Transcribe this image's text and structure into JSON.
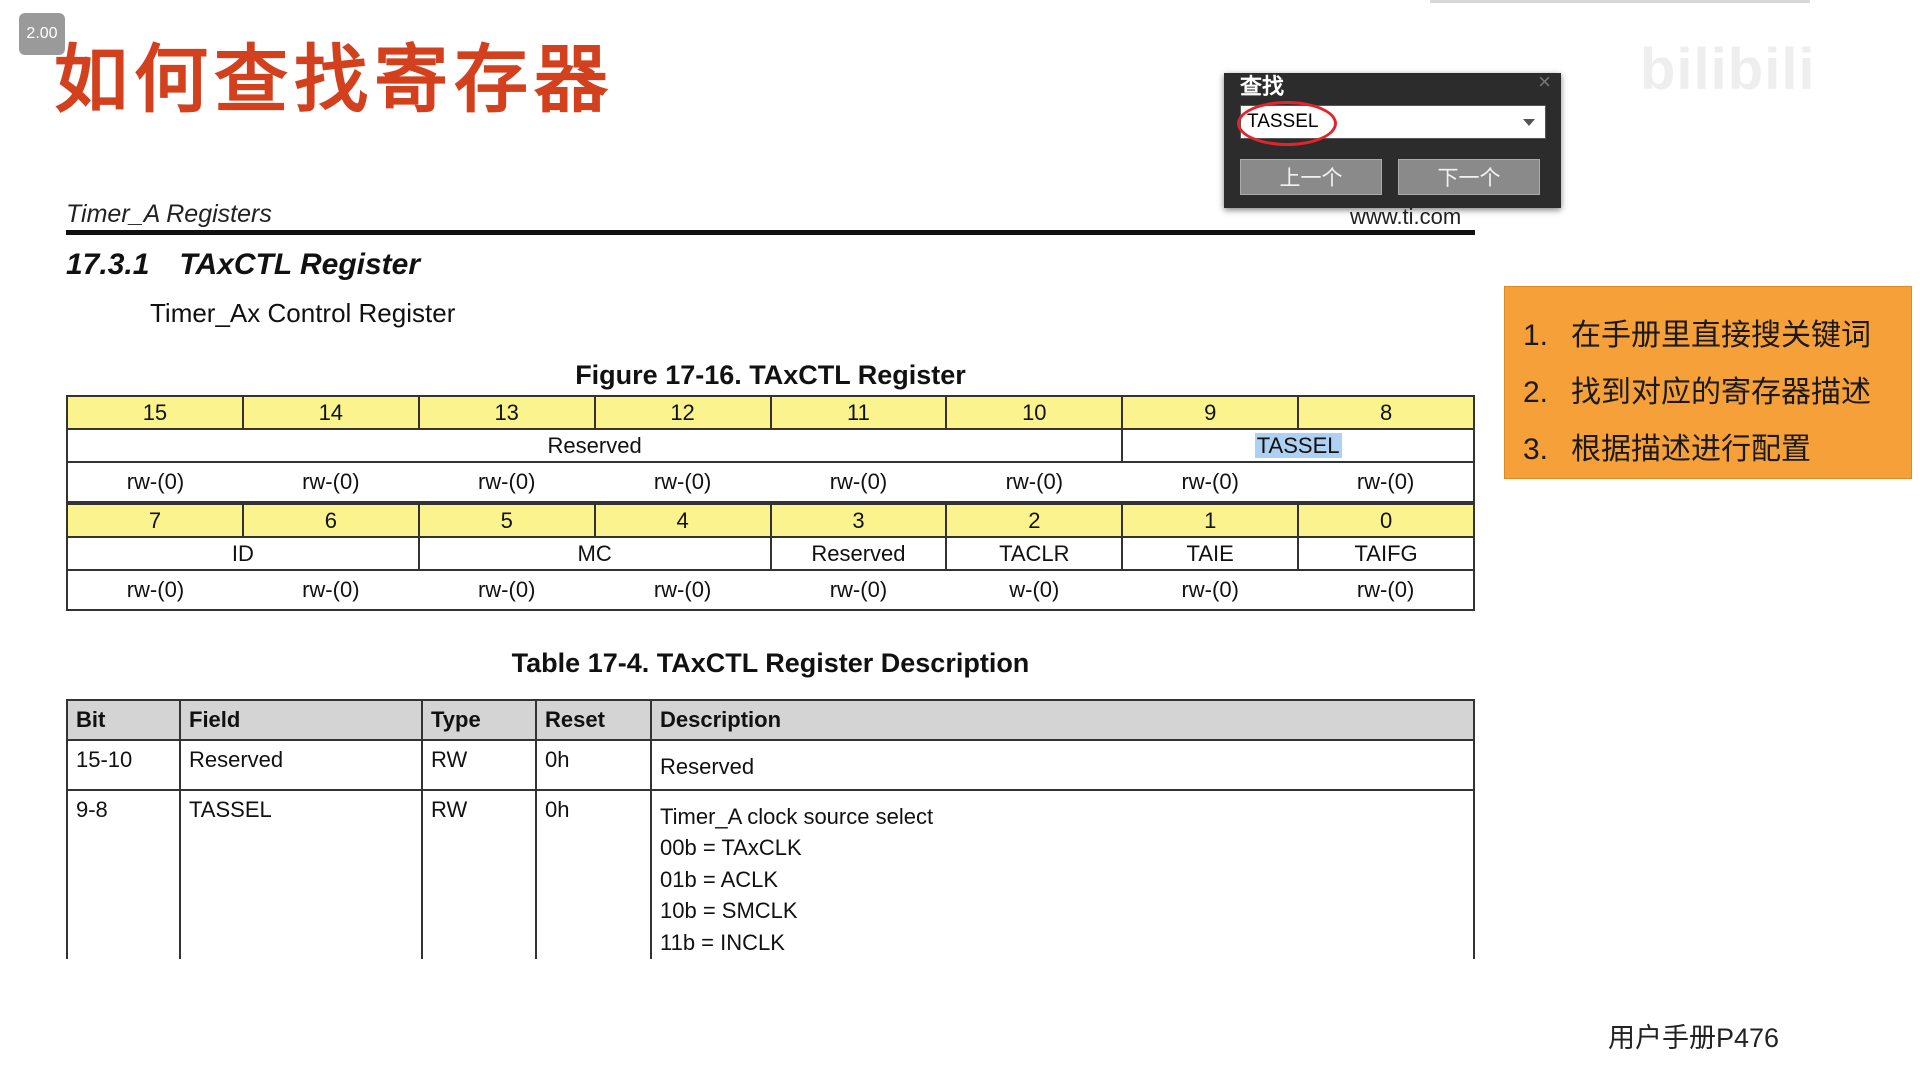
{
  "speed_badge": "2.00",
  "slide_title": "如何查找寄存器",
  "watermark": "bilibili",
  "doc_header": {
    "left": "Timer_A Registers",
    "right": "www.ti.com"
  },
  "section": {
    "number": "17.3.1",
    "title": "TAxCTL Register",
    "subtitle": "Timer_Ax Control Register"
  },
  "figure_title": "Figure 17-16. TAxCTL Register",
  "register_high": {
    "bits": [
      "15",
      "14",
      "13",
      "12",
      "11",
      "10",
      "9",
      "8"
    ],
    "fields": [
      {
        "name": "Reserved",
        "span": 6
      },
      {
        "name": "TASSEL",
        "span": 2
      }
    ],
    "access": [
      "rw-(0)",
      "rw-(0)",
      "rw-(0)",
      "rw-(0)",
      "rw-(0)",
      "rw-(0)",
      "rw-(0)",
      "rw-(0)"
    ]
  },
  "register_low": {
    "bits": [
      "7",
      "6",
      "5",
      "4",
      "3",
      "2",
      "1",
      "0"
    ],
    "fields": [
      {
        "name": "ID",
        "span": 2
      },
      {
        "name": "MC",
        "span": 2
      },
      {
        "name": "Reserved",
        "span": 1
      },
      {
        "name": "TACLR",
        "span": 1
      },
      {
        "name": "TAIE",
        "span": 1
      },
      {
        "name": "TAIFG",
        "span": 1
      }
    ],
    "access": [
      "rw-(0)",
      "rw-(0)",
      "rw-(0)",
      "rw-(0)",
      "rw-(0)",
      "w-(0)",
      "rw-(0)",
      "rw-(0)"
    ]
  },
  "table_title": "Table 17-4. TAxCTL Register Description",
  "desc_table": {
    "headers": [
      "Bit",
      "Field",
      "Type",
      "Reset",
      "Description"
    ],
    "rows": [
      {
        "bit": "15-10",
        "field": "Reserved",
        "type": "RW",
        "reset": "0h",
        "desc": "Reserved",
        "options": []
      },
      {
        "bit": "9-8",
        "field": "TASSEL",
        "type": "RW",
        "reset": "0h",
        "desc": "Timer_A clock source select",
        "options": [
          "00b = TAxCLK",
          "01b = ACLK",
          "10b = SMCLK",
          "11b = INCLK"
        ]
      }
    ]
  },
  "find_dialog": {
    "title": "查找",
    "query": "TASSEL",
    "prev_label": "上一个",
    "next_label": "下一个",
    "close": "×"
  },
  "note": {
    "items": [
      {
        "num": "1.",
        "text": "在手册里直接搜关键词"
      },
      {
        "num": "2.",
        "text": "找到对应的寄存器描述"
      },
      {
        "num": "3.",
        "text": "根据描述进行配置"
      }
    ]
  },
  "page_ref": "用户手册P476",
  "colors": {
    "title_red": "#d2401e",
    "bit_row_yellow": "#fbf38e",
    "note_orange": "#f6a03a",
    "highlight_blue": "#aed0f2",
    "annotation_red": "#e3242b"
  }
}
